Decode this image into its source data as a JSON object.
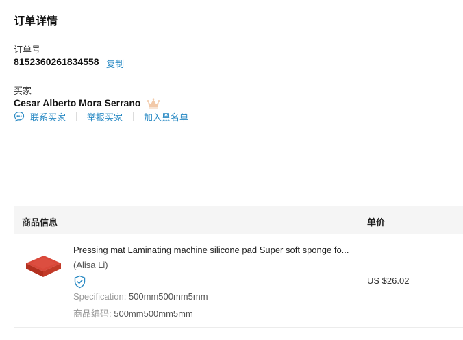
{
  "order": {
    "section_title": "订单详情",
    "number_label": "订单号",
    "number_value": "8152360261834558",
    "copy_label": "复制"
  },
  "buyer": {
    "label": "买家",
    "name": "Cesar Alberto Mora Serrano",
    "badge_icon": "crown-icon",
    "actions": {
      "contact": "联系买家",
      "report": "举报买家",
      "blacklist": "加入黑名单"
    }
  },
  "table": {
    "headers": {
      "product": "商品信息",
      "price": "单价"
    },
    "rows": [
      {
        "name": "Pressing mat Laminating machine silicone pad Super soft sponge fo...",
        "seller": "(Alisa Li)",
        "spec_label": "Specification: ",
        "spec_value": "500mm500mm5mm",
        "code_label": "商品编码: ",
        "code_value": "500mm500mm5mm",
        "price": "US $26.02"
      }
    ]
  },
  "colors": {
    "link": "#2a8ac4",
    "header_bg": "#f5f5f5",
    "crown": "#f2c9a8",
    "product": "#c8382a"
  }
}
